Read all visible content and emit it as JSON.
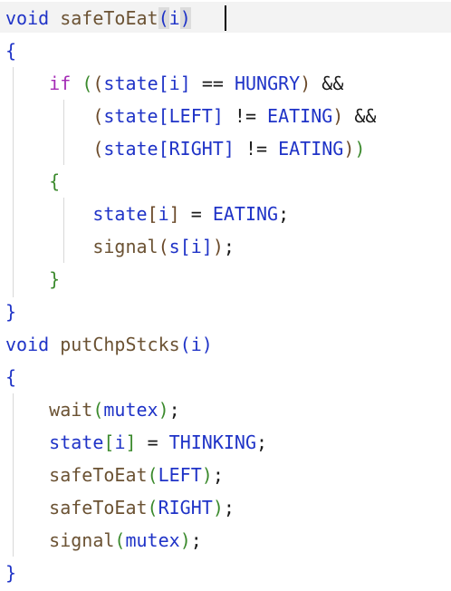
{
  "code_lines": [
    "void safeToEat(i)",
    "{",
    "    if ((state[i] == HUNGRY) &&",
    "        (state[LEFT] != EATING) &&",
    "        (state[RIGHT] != EATING))",
    "    {",
    "        state[i] = EATING;",
    "        signal(s[i]);",
    "    }",
    "}",
    "void putChpStcks(i)",
    "{",
    "    wait(mutex);",
    "    state[i] = THINKING;",
    "    safeToEat(LEFT);",
    "    safeToEat(RIGHT);",
    "    signal(mutex);",
    "}"
  ],
  "colors": {
    "keyword": "#1f33c7",
    "if_keyword": "#a42bb5",
    "function": "#6b5233",
    "bracket_level1": "#1f33c7",
    "bracket_level2": "#3b8a2d",
    "bracket_level3": "#6b4a2a",
    "current_line_highlight": "#f3f3f3"
  }
}
